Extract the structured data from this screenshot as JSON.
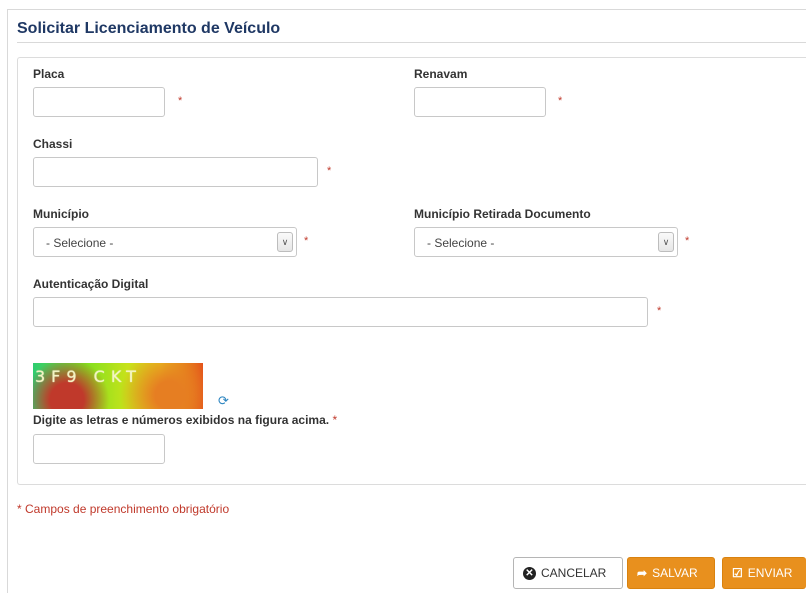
{
  "page": {
    "title": "Solicitar Licenciamento de Veículo",
    "required_marker": "*",
    "required_note": "* Campos de preenchimento obrigatório"
  },
  "form": {
    "placa": {
      "label": "Placa",
      "value": ""
    },
    "renavam": {
      "label": "Renavam",
      "value": ""
    },
    "chassi": {
      "label": "Chassi",
      "value": ""
    },
    "municipio": {
      "label": "Município",
      "selected": "- Selecione -"
    },
    "municipio_retirada": {
      "label": "Município Retirada Documento",
      "selected": "- Selecione -"
    },
    "autenticacao": {
      "label": "Autenticação Digital",
      "value": ""
    },
    "captcha": {
      "image_text": "3F9 CKT",
      "prompt": "Digite as letras e números exibidos na figura acima.",
      "value": ""
    }
  },
  "buttons": {
    "cancel": "CANCELAR",
    "save": "SALVAR",
    "send": "ENVIAR"
  },
  "icons": {
    "cancel": "close-circle-icon",
    "save": "save-share-icon",
    "send": "check-square-icon",
    "refresh": "refresh-icon",
    "select_arrow": "chevron-down-icon"
  },
  "colors": {
    "title": "#1f3864",
    "required": "#c0392b",
    "accent_button": "#e8901e"
  }
}
